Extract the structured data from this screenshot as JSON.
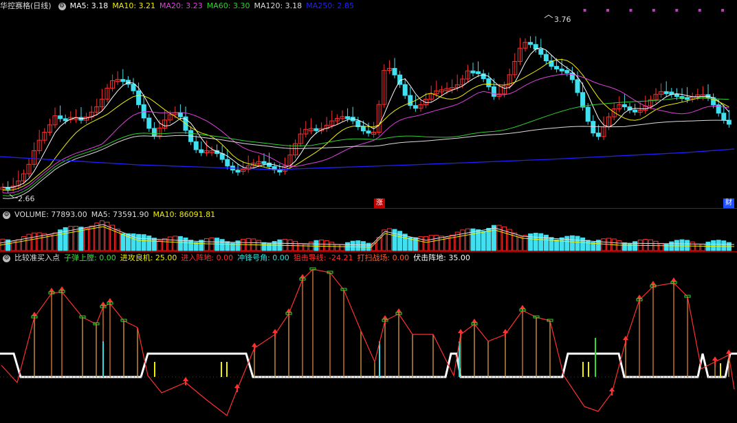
{
  "main": {
    "name": "华控赛格(日线)",
    "indicators": [
      {
        "label": "MA5: 3.18",
        "color": "#ffffff"
      },
      {
        "label": "MA10: 3.21",
        "color": "#f0f000"
      },
      {
        "label": "MA20: 3.23",
        "color": "#e040e0"
      },
      {
        "label": "MA60: 3.30",
        "color": "#30d030"
      },
      {
        "label": "MA120: 3.18",
        "color": "#dddddd"
      },
      {
        "label": "MA250: 2.85",
        "color": "#2020ff"
      }
    ],
    "high_label": "3.76",
    "low_label": "2.66",
    "tag_rise": "涨",
    "tag_fin": "财"
  },
  "volume": {
    "indicators": [
      {
        "label": "VOLUME: 77893.00",
        "color": "#dddddd"
      },
      {
        "label": "MA5: 73591.90",
        "color": "#dddddd"
      },
      {
        "label": "MA10: 86091.81",
        "color": "#f0f000"
      }
    ]
  },
  "signal": {
    "title": "比较准买入点",
    "indicators": [
      {
        "label": "子弹上膛: 0.00",
        "color": "#30e030"
      },
      {
        "label": "进攻良机: 25.00",
        "color": "#f0f000"
      },
      {
        "label": "进入阵地: 0.00",
        "color": "#ff3030"
      },
      {
        "label": "冲锋号角: 0.00",
        "color": "#30e0e0"
      },
      {
        "label": "狙击导线: -24.21",
        "color": "#ff3030"
      },
      {
        "label": "打扫战场: 0.00",
        "color": "#ff6030"
      },
      {
        "label": "伏击阵地: 35.00",
        "color": "#ffffff"
      }
    ]
  },
  "colors": {
    "up": "#ff3030",
    "down": "#40e0f0",
    "frame": "#b00000"
  }
}
